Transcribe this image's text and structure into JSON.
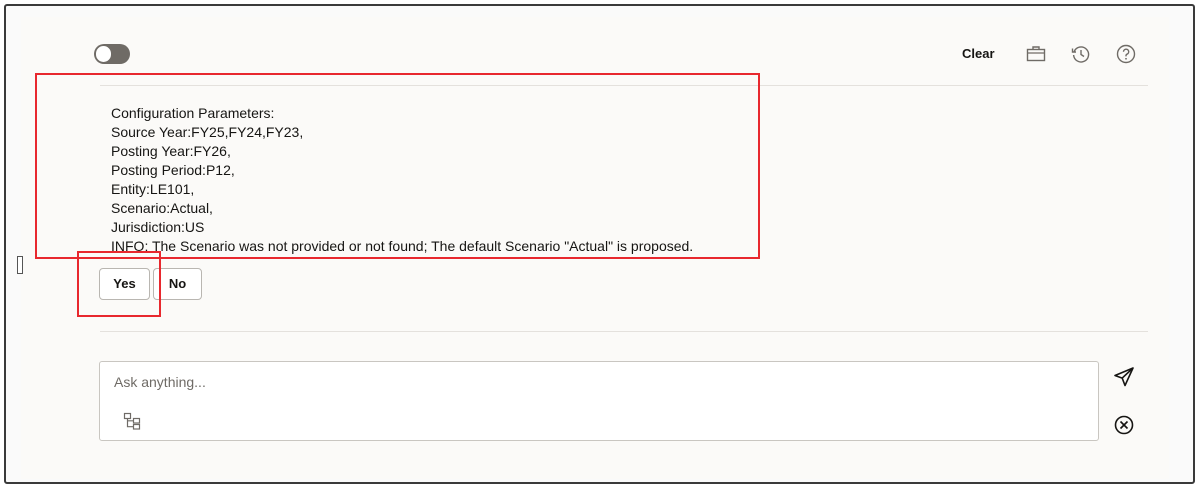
{
  "header": {
    "clear_label": "Clear",
    "icons": [
      "briefcase-icon",
      "history-icon",
      "help-icon"
    ],
    "toggle_state": "off"
  },
  "message": {
    "lines": [
      "Configuration Parameters:",
      "Source Year:FY25,FY24,FY23,",
      "Posting Year:FY26,",
      "Posting Period:P12,",
      "Entity:LE101,",
      "Scenario:Actual,",
      "Jurisdiction:US",
      "INFO: The Scenario was not provided or not found; The default Scenario \"Actual\" is proposed."
    ]
  },
  "choices": {
    "yes_label": "Yes",
    "no_label": "No"
  },
  "input": {
    "placeholder": "Ask anything...",
    "value": ""
  },
  "colors": {
    "annotation_red": "#e8282e",
    "text": "#161513",
    "panel_bg": "#fbfaf8"
  }
}
